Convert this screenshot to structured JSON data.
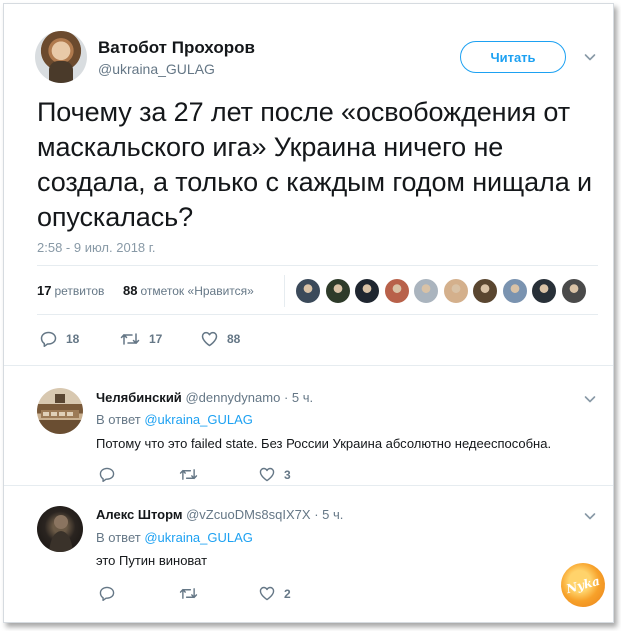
{
  "tweet": {
    "author": {
      "display_name": "Ватобот Прохоров",
      "handle": "@ukraina_GULAG"
    },
    "follow_label": "Читать",
    "text": "Почему за 27 лет после «освобождения от маскальского ига» Украина ничего не создала, а только с каждым годом нищала и опускалась?",
    "timestamp": "2:58 - 9 июл. 2018 г.",
    "stats": {
      "retweets_count": "17",
      "retweets_label": "ретвитов",
      "likes_count": "88",
      "likes_label": "отметок «Нравится»"
    },
    "likers": [
      {
        "icon": "liker-avatar",
        "color": "#3b4a5a"
      },
      {
        "icon": "liker-avatar",
        "color": "#2e3b2a"
      },
      {
        "icon": "liker-avatar",
        "color": "#1f2630"
      },
      {
        "icon": "liker-avatar",
        "color": "#b8614a"
      },
      {
        "icon": "liker-avatar",
        "color": "#aab4be"
      },
      {
        "icon": "liker-avatar",
        "color": "#d4b08c"
      },
      {
        "icon": "liker-avatar",
        "color": "#5a4630"
      },
      {
        "icon": "liker-avatar",
        "color": "#7a93b0"
      },
      {
        "icon": "liker-avatar",
        "color": "#283038"
      },
      {
        "icon": "liker-avatar",
        "color": "#4a4a4a"
      }
    ],
    "actions": {
      "replies": "18",
      "retweets": "17",
      "likes": "88"
    }
  },
  "replies": [
    {
      "display_name": "Челябинский",
      "handle": "@dennydynamo",
      "time": "· 5 ч.",
      "in_reply_prefix": "В ответ",
      "in_reply_handle": "@ukraina_GULAG",
      "text": "Потому что это failed state. Без России Украина абсолютно недееспособна.",
      "likes": "3"
    },
    {
      "display_name": "Алекс Шторм",
      "handle": "@vZcuoDMs8sqIX7X",
      "time": "· 5 ч.",
      "in_reply_prefix": "В ответ",
      "in_reply_handle": "@ukraina_GULAG",
      "text": "это Путин виноват",
      "likes": "2"
    }
  ],
  "watermark": "Nyka",
  "colors": {
    "accent": "#1da1f2",
    "muted": "#657786",
    "text": "#14171a",
    "border": "#e6ecf0"
  }
}
